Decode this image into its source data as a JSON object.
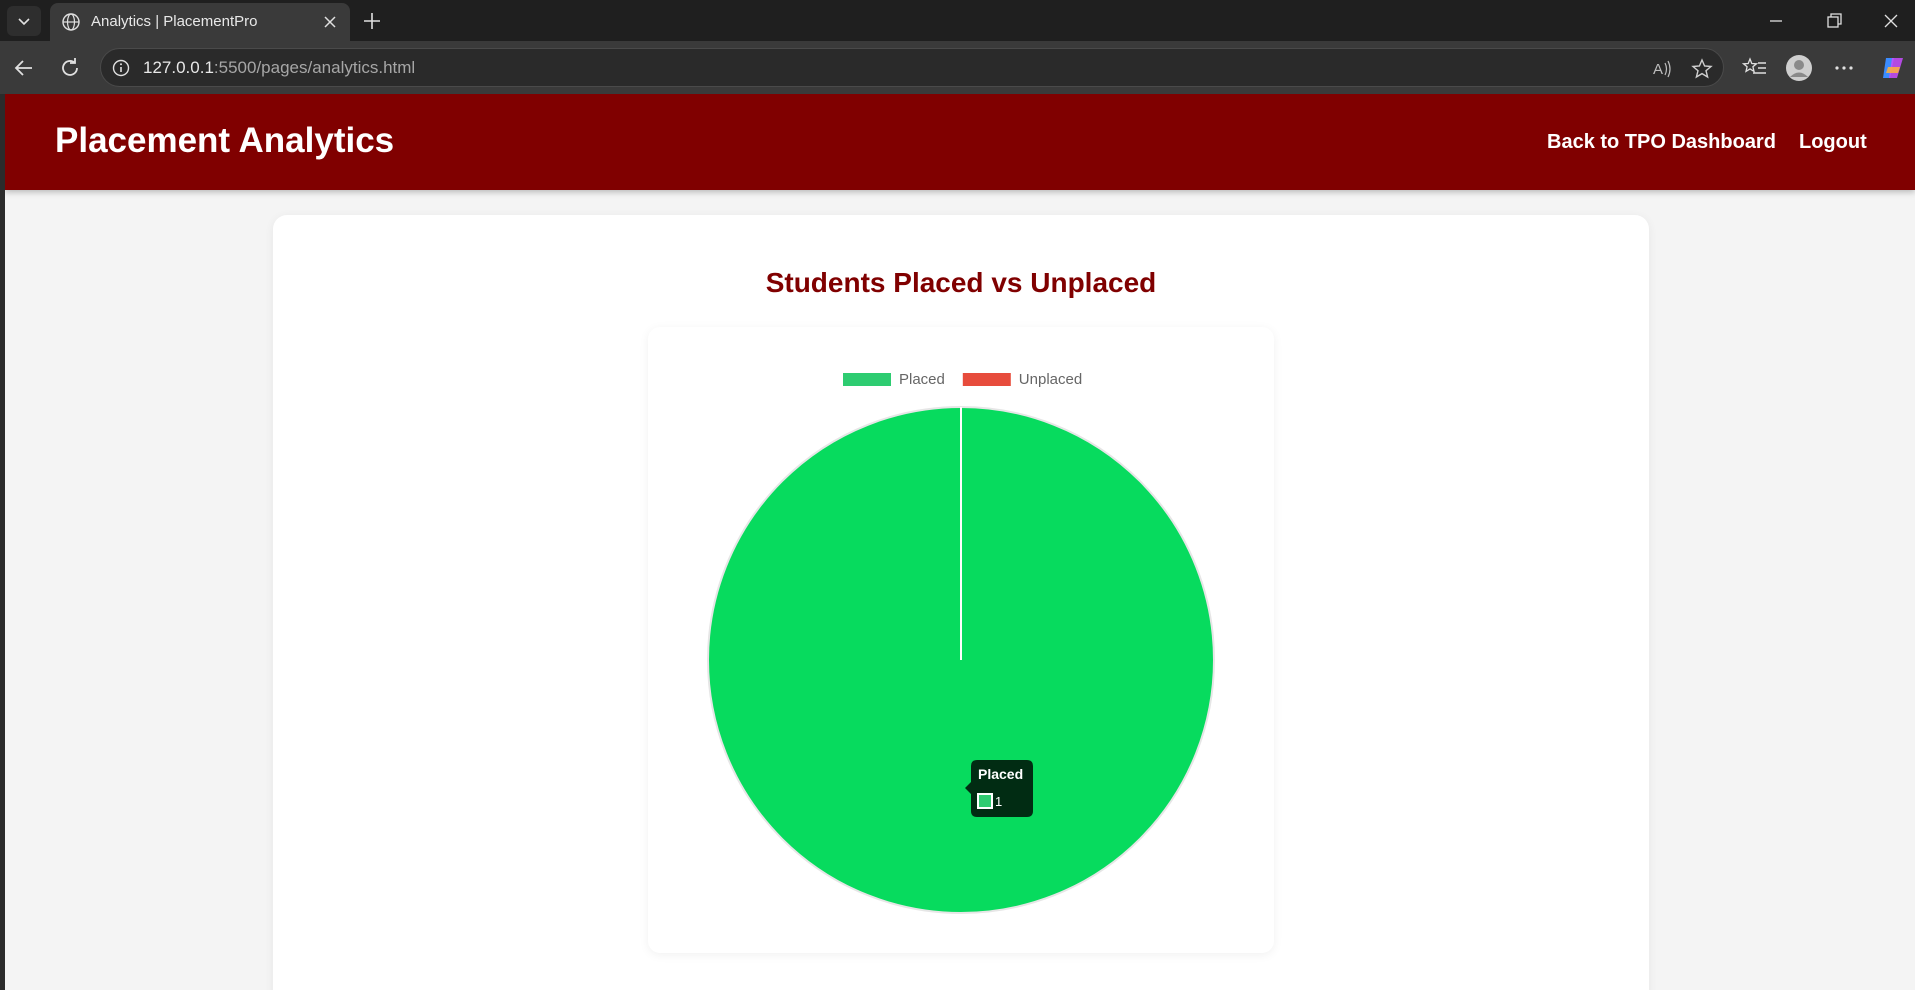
{
  "browser": {
    "tab_title": "Analytics | PlacementPro",
    "url_host": "127.0.0.1",
    "url_rest": ":5500/pages/analytics.html"
  },
  "header": {
    "title": "Placement Analytics",
    "nav": [
      {
        "label": "Back to TPO Dashboard"
      },
      {
        "label": "Logout"
      }
    ]
  },
  "card": {
    "title": "Students Placed vs Unplaced"
  },
  "chart_data": {
    "type": "pie",
    "categories": [
      "Placed",
      "Unplaced"
    ],
    "values": [
      1,
      0
    ],
    "colors": [
      "#07db5e",
      "#e74c3c"
    ],
    "legend_colors": [
      "#2ecc71",
      "#e74c3c"
    ],
    "legend_position": "top",
    "tooltip": {
      "label": "Placed",
      "value": "1"
    }
  }
}
